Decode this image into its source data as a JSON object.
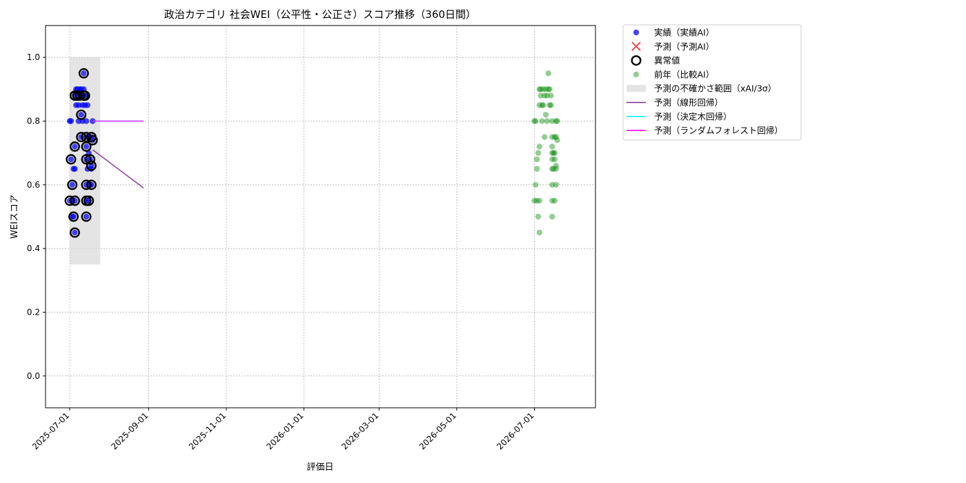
{
  "chart_data": {
    "type": "scatter",
    "title": "政治カテゴリ 社会WEI（公平性・公正さ）スコア推移（360日間）",
    "xlabel": "評価日",
    "ylabel": "WEIスコア",
    "xlim": [
      "2025-06-12",
      "2026-08-18"
    ],
    "ylim": [
      -0.1,
      1.1
    ],
    "x_ticks": [
      "2025-07-01",
      "2025-09-01",
      "2025-11-01",
      "2026-01-01",
      "2026-03-01",
      "2026-05-01",
      "2026-07-01"
    ],
    "y_ticks": [
      "0.0",
      "0.2",
      "0.4",
      "0.6",
      "0.8",
      "1.0"
    ],
    "grid": true,
    "legend_position": "outside-upper-right",
    "legend": [
      {
        "key": "actual",
        "label": "実績（実績AI）"
      },
      {
        "key": "pred",
        "label": "予測（予測AI）"
      },
      {
        "key": "anomaly",
        "label": "異常値"
      },
      {
        "key": "prev",
        "label": "前年（比較AI）"
      },
      {
        "key": "band",
        "label": "予測の不確かさ範囲（xAI/3σ）"
      },
      {
        "key": "linear",
        "label": "予測（線形回帰）"
      },
      {
        "key": "tree",
        "label": "予測（決定木回帰）"
      },
      {
        "key": "forest",
        "label": "予測（ランダムフォレスト回帰）"
      }
    ],
    "colors": {
      "actual": "#0000ee",
      "pred": "#ff3333",
      "anomaly": "#000000",
      "prev": "#008800",
      "band": "#d9d9d9",
      "linear": "#7b2d8e",
      "tree": "#00ffff",
      "forest": "#ff00ff"
    },
    "uncertainty_band": {
      "x": [
        "2025-07-01",
        "2025-07-25"
      ],
      "y": [
        0.35,
        1.0
      ]
    },
    "series": [
      {
        "name": "実績（実績AI）",
        "points": [
          [
            "2025-07-01",
            0.8
          ],
          [
            "2025-07-01",
            0.55
          ],
          [
            "2025-07-02",
            0.8
          ],
          [
            "2025-07-02",
            0.68
          ],
          [
            "2025-07-03",
            0.6
          ],
          [
            "2025-07-03",
            0.55
          ],
          [
            "2025-07-03",
            0.5
          ],
          [
            "2025-07-04",
            0.65
          ],
          [
            "2025-07-04",
            0.5
          ],
          [
            "2025-07-05",
            0.72
          ],
          [
            "2025-07-05",
            0.65
          ],
          [
            "2025-07-05",
            0.55
          ],
          [
            "2025-07-05",
            0.45
          ],
          [
            "2025-07-05",
            0.88
          ],
          [
            "2025-07-06",
            0.9
          ],
          [
            "2025-07-06",
            0.85
          ],
          [
            "2025-07-07",
            0.9
          ],
          [
            "2025-07-07",
            0.88
          ],
          [
            "2025-07-08",
            0.8
          ],
          [
            "2025-07-08",
            0.85
          ],
          [
            "2025-07-09",
            0.9
          ],
          [
            "2025-07-09",
            0.88
          ],
          [
            "2025-07-10",
            0.82
          ],
          [
            "2025-07-10",
            0.75
          ],
          [
            "2025-07-10",
            0.9
          ],
          [
            "2025-07-11",
            0.85
          ],
          [
            "2025-07-11",
            0.8
          ],
          [
            "2025-07-12",
            0.95
          ],
          [
            "2025-07-12",
            0.9
          ],
          [
            "2025-07-12",
            0.88
          ],
          [
            "2025-07-13",
            0.88
          ],
          [
            "2025-07-13",
            0.85
          ],
          [
            "2025-07-14",
            0.72
          ],
          [
            "2025-07-14",
            0.68
          ],
          [
            "2025-07-14",
            0.6
          ],
          [
            "2025-07-14",
            0.55
          ],
          [
            "2025-07-14",
            0.5
          ],
          [
            "2025-07-14",
            0.8
          ],
          [
            "2025-07-14",
            0.75
          ],
          [
            "2025-07-15",
            0.65
          ],
          [
            "2025-07-15",
            0.85
          ],
          [
            "2025-07-16",
            0.75
          ],
          [
            "2025-07-16",
            0.7
          ],
          [
            "2025-07-16",
            0.55
          ],
          [
            "2025-07-17",
            0.68
          ],
          [
            "2025-07-17",
            0.6
          ],
          [
            "2025-07-18",
            0.75
          ],
          [
            "2025-07-18",
            0.66
          ],
          [
            "2025-07-18",
            0.65
          ],
          [
            "2025-07-18",
            0.6
          ],
          [
            "2025-07-19",
            0.74
          ],
          [
            "2025-07-19",
            0.8
          ]
        ]
      },
      {
        "name": "異常値",
        "points": [
          [
            "2025-07-01",
            0.55
          ],
          [
            "2025-07-02",
            0.68
          ],
          [
            "2025-07-03",
            0.6
          ],
          [
            "2025-07-04",
            0.5
          ],
          [
            "2025-07-05",
            0.72
          ],
          [
            "2025-07-05",
            0.55
          ],
          [
            "2025-07-05",
            0.45
          ],
          [
            "2025-07-05",
            0.88
          ],
          [
            "2025-07-07",
            0.88
          ],
          [
            "2025-07-09",
            0.88
          ],
          [
            "2025-07-10",
            0.82
          ],
          [
            "2025-07-10",
            0.75
          ],
          [
            "2025-07-12",
            0.95
          ],
          [
            "2025-07-12",
            0.88
          ],
          [
            "2025-07-13",
            0.88
          ],
          [
            "2025-07-14",
            0.75
          ],
          [
            "2025-07-14",
            0.72
          ],
          [
            "2025-07-14",
            0.68
          ],
          [
            "2025-07-14",
            0.6
          ],
          [
            "2025-07-14",
            0.55
          ],
          [
            "2025-07-14",
            0.5
          ],
          [
            "2025-07-16",
            0.55
          ],
          [
            "2025-07-17",
            0.68
          ],
          [
            "2025-07-18",
            0.75
          ],
          [
            "2025-07-18",
            0.66
          ],
          [
            "2025-07-18",
            0.6
          ],
          [
            "2025-07-19",
            0.74
          ]
        ]
      },
      {
        "name": "前年（比較AI）",
        "points": [
          [
            "2026-07-01",
            0.8
          ],
          [
            "2026-07-01",
            0.55
          ],
          [
            "2026-07-02",
            0.8
          ],
          [
            "2026-07-02",
            0.6
          ],
          [
            "2026-07-03",
            0.68
          ],
          [
            "2026-07-03",
            0.65
          ],
          [
            "2026-07-03",
            0.55
          ],
          [
            "2026-07-04",
            0.5
          ],
          [
            "2026-07-04",
            0.7
          ],
          [
            "2026-07-05",
            0.9
          ],
          [
            "2026-07-05",
            0.85
          ],
          [
            "2026-07-05",
            0.72
          ],
          [
            "2026-07-05",
            0.55
          ],
          [
            "2026-07-05",
            0.45
          ],
          [
            "2026-07-06",
            0.9
          ],
          [
            "2026-07-06",
            0.88
          ],
          [
            "2026-07-07",
            0.85
          ],
          [
            "2026-07-07",
            0.8
          ],
          [
            "2026-07-08",
            0.9
          ],
          [
            "2026-07-08",
            0.85
          ],
          [
            "2026-07-09",
            0.75
          ],
          [
            "2026-07-09",
            0.88
          ],
          [
            "2026-07-10",
            0.82
          ],
          [
            "2026-07-10",
            0.9
          ],
          [
            "2026-07-11",
            0.8
          ],
          [
            "2026-07-11",
            0.88
          ],
          [
            "2026-07-12",
            0.9
          ],
          [
            "2026-07-12",
            0.95
          ],
          [
            "2026-07-13",
            0.85
          ],
          [
            "2026-07-13",
            0.9
          ],
          [
            "2026-07-14",
            0.88
          ],
          [
            "2026-07-14",
            0.85
          ],
          [
            "2026-07-15",
            0.8
          ],
          [
            "2026-07-15",
            0.75
          ],
          [
            "2026-07-15",
            0.72
          ],
          [
            "2026-07-15",
            0.7
          ],
          [
            "2026-07-15",
            0.68
          ],
          [
            "2026-07-15",
            0.65
          ],
          [
            "2026-07-15",
            0.6
          ],
          [
            "2026-07-15",
            0.55
          ],
          [
            "2026-07-15",
            0.5
          ],
          [
            "2026-07-16",
            0.7
          ],
          [
            "2026-07-16",
            0.65
          ],
          [
            "2026-07-17",
            0.75
          ],
          [
            "2026-07-17",
            0.7
          ],
          [
            "2026-07-17",
            0.68
          ],
          [
            "2026-07-17",
            0.55
          ],
          [
            "2026-07-18",
            0.8
          ],
          [
            "2026-07-18",
            0.75
          ],
          [
            "2026-07-18",
            0.66
          ],
          [
            "2026-07-18",
            0.65
          ],
          [
            "2026-07-18",
            0.6
          ],
          [
            "2026-07-19",
            0.74
          ],
          [
            "2026-07-19",
            0.8
          ]
        ]
      },
      {
        "name": "予測（線形回帰）",
        "points": [
          [
            "2025-07-19",
            0.71
          ],
          [
            "2025-08-28",
            0.59
          ]
        ]
      },
      {
        "name": "予測（決定木回帰）",
        "points": [
          [
            "2025-07-19",
            0.8
          ],
          [
            "2025-08-28",
            0.8
          ]
        ]
      },
      {
        "name": "予測（ランダムフォレスト回帰）",
        "points": [
          [
            "2025-07-19",
            0.8
          ],
          [
            "2025-08-28",
            0.8
          ]
        ]
      }
    ]
  }
}
